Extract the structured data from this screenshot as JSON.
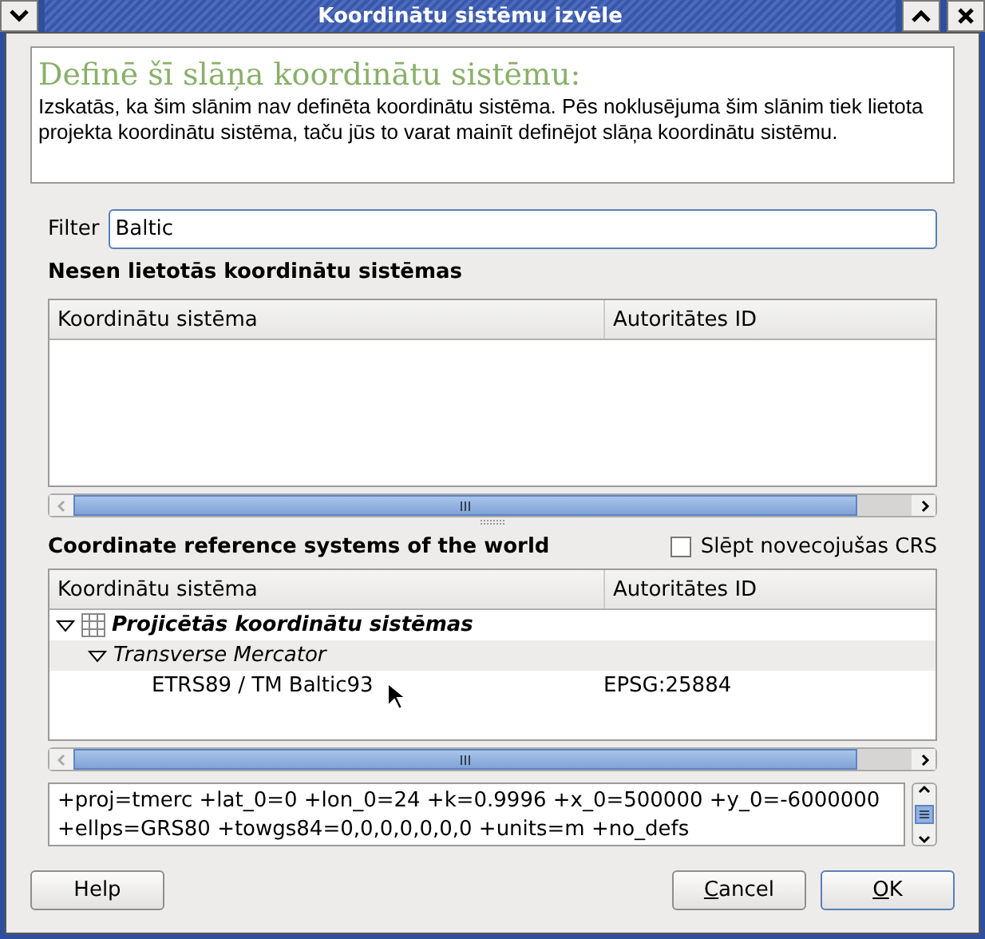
{
  "window": {
    "title": "Koordinātu sistēmu izvēle"
  },
  "info": {
    "heading": "Definē šī slāņa koordinātu sistēmu:",
    "text": "Izskatās, ka šim slānim nav definēta koordinātu sistēma. Pēs noklusējuma šim slānim tiek lietota projekta koordinātu sistēma, taču jūs to varat mainīt definējot slāņa koordinātu sistēmu."
  },
  "filter": {
    "label": "Filter",
    "value": "Baltic"
  },
  "recent": {
    "heading": "Nesen lietotās koordinātu sistēmas",
    "columns": [
      "Koordinātu sistēma",
      "Autoritātes ID"
    ]
  },
  "world": {
    "heading": "Coordinate reference systems of the world",
    "hide_deprecated": {
      "label": "Slēpt novecojušas CRS",
      "checked": false
    },
    "columns": [
      "Koordinātu sistēma",
      "Autoritātes ID"
    ],
    "tree": [
      {
        "label": "Projicētās koordinātu sistēmas",
        "expanded": true,
        "children": [
          {
            "label": "Transverse Mercator",
            "expanded": true,
            "children": [
              {
                "label": "ETRS89 / TM Baltic93",
                "authority": "EPSG:25884"
              }
            ]
          }
        ]
      }
    ]
  },
  "proj_text": "+proj=tmerc +lat_0=0 +lon_0=24 +k=0.9996 +x_0=500000 +y_0=-6000000 +ellps=GRS80 +towgs84=0,0,0,0,0,0,0 +units=m +no_defs",
  "buttons": [
    {
      "label": "Help",
      "mnemonic": false,
      "default": false
    },
    {
      "label": "Cancel",
      "mnemonic": true,
      "default": false
    },
    {
      "label": "OK",
      "mnemonic": true,
      "default": true
    }
  ]
}
